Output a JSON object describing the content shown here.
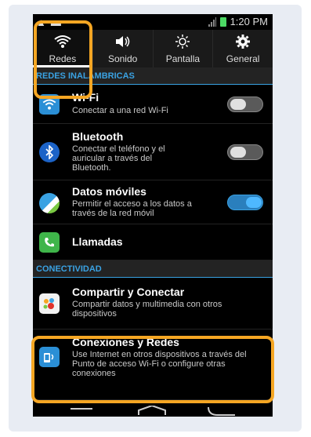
{
  "status_bar": {
    "time": "1:20 PM"
  },
  "tabs": [
    {
      "label": "Redes",
      "icon": "wifi-icon",
      "active": true
    },
    {
      "label": "Sonido",
      "icon": "speaker-icon",
      "active": false
    },
    {
      "label": "Pantalla",
      "icon": "brightness-icon",
      "active": false
    },
    {
      "label": "General",
      "icon": "gear-icon",
      "active": false
    }
  ],
  "sections": {
    "wireless": "REDES INALÁMBRICAS",
    "connectivity": "CONECTIVIDAD"
  },
  "items": {
    "wifi": {
      "title": "Wi-Fi",
      "subtitle": "Conectar a una red Wi-Fi",
      "toggle": "off"
    },
    "bluetooth": {
      "title": "Bluetooth",
      "subtitle": "Conectar el teléfono y el auricular a través del Bluetooth.",
      "toggle": "off"
    },
    "mobile_data": {
      "title": "Datos móviles",
      "subtitle": "Permitir el acceso a los datos a través de la red móvil",
      "toggle": "on"
    },
    "calls": {
      "title": "Llamadas"
    },
    "share": {
      "title": "Compartir y Conectar",
      "subtitle": "Compartir datos y multimedia con otros dispositivos"
    },
    "connections": {
      "title": "Conexiones y Redes",
      "subtitle": "Use Internet en otros dispositivos a través del Punto de acceso Wi-Fi o configure otras conexiones"
    }
  },
  "colors": {
    "accent": "#3aa2e3",
    "highlight": "#f5a623",
    "toggle_on": "#4eb8ff"
  }
}
